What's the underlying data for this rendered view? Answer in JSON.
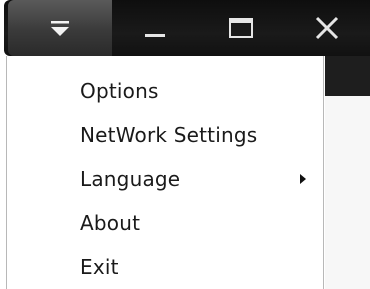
{
  "titlebar": {
    "buttons": [
      {
        "name": "menu",
        "icon": "dropdown-menu-icon"
      },
      {
        "name": "minimize",
        "icon": "minimize-icon"
      },
      {
        "name": "maximize",
        "icon": "maximize-icon"
      },
      {
        "name": "close",
        "icon": "close-icon"
      }
    ]
  },
  "menu": {
    "items": [
      {
        "label": "Options",
        "has_submenu": false
      },
      {
        "label": "NetWork Settings",
        "has_submenu": false
      },
      {
        "label": "Language",
        "has_submenu": true
      },
      {
        "label": "About",
        "has_submenu": false
      },
      {
        "label": "Exit",
        "has_submenu": false
      }
    ]
  },
  "colors": {
    "titlebar_background": "#111111",
    "menu_button_background": "#4a4a4a",
    "menu_background": "#ffffff",
    "menu_text": "#1a1a1a"
  }
}
